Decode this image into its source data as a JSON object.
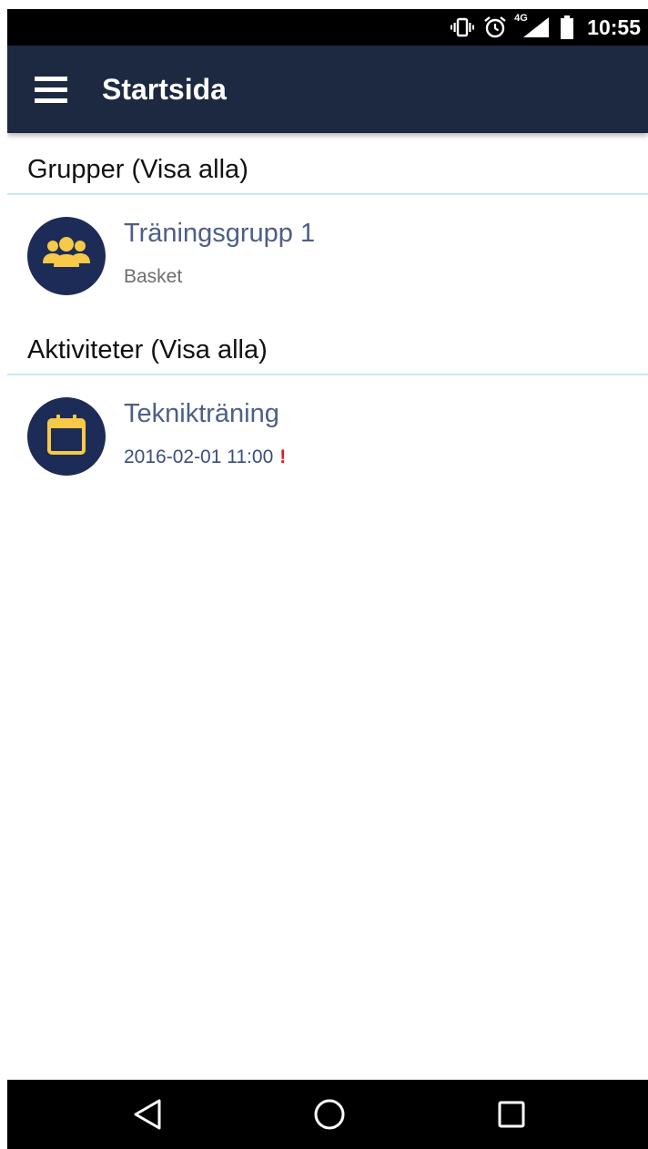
{
  "status_bar": {
    "time": "10:55",
    "icons": [
      "vibrate-icon",
      "alarm-icon",
      "signal-4g-icon",
      "battery-icon"
    ],
    "network_label": "4G"
  },
  "app_bar": {
    "title": "Startsida",
    "menu_icon": "hamburger-menu-icon",
    "background": "#1c2940"
  },
  "sections": {
    "groups": {
      "header": "Grupper (Visa alla)",
      "items": [
        {
          "title": "Träningsgrupp 1",
          "subtitle": "Basket",
          "icon": "group-icon"
        }
      ]
    },
    "activities": {
      "header": "Aktiviteter (Visa alla)",
      "items": [
        {
          "title": "Teknikträning",
          "datetime": "2016-02-01 11:00",
          "alert": "!",
          "icon": "calendar-icon"
        }
      ]
    }
  },
  "colors": {
    "avatar_bg": "#1c2c56",
    "icon_accent": "#f7c948",
    "item_title": "#4d5f86",
    "alert": "#e21b1b",
    "divider": "#cbe7f2"
  },
  "nav_bar": {
    "buttons": [
      "back-icon",
      "home-icon",
      "recents-icon"
    ]
  }
}
